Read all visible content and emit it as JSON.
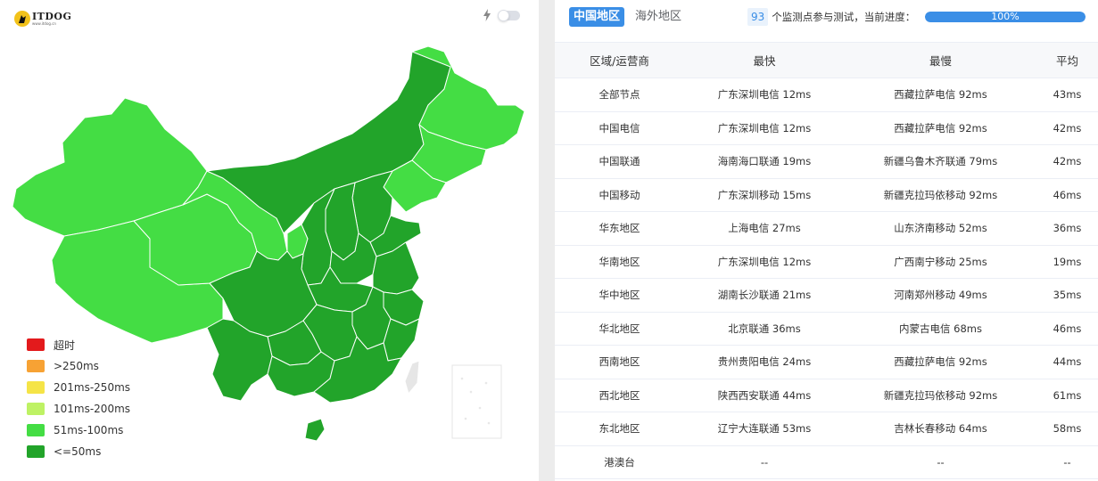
{
  "logo": {
    "name": "ITDOG",
    "url": "www.itdog.cn"
  },
  "colors": {
    "timeout": "#e31a1c",
    "over250": "#f7a234",
    "r201_250": "#f5e447",
    "r101_200": "#bef264",
    "r51_100": "#44dd44",
    "le50": "#22a42a",
    "accent": "#3a8ee6"
  },
  "legend": [
    {
      "label": "超时",
      "color": "#e31a1c"
    },
    {
      "label": ">250ms",
      "color": "#f7a234"
    },
    {
      "label": "201ms-250ms",
      "color": "#f5e447"
    },
    {
      "label": "101ms-200ms",
      "color": "#bef264"
    },
    {
      "label": "51ms-100ms",
      "color": "#44dd44"
    },
    {
      "label": "<=50ms",
      "color": "#22a42a"
    }
  ],
  "tabs": [
    {
      "label": "中国地区",
      "active": true
    },
    {
      "label": "海外地区",
      "active": false
    }
  ],
  "stat": {
    "count": "93",
    "text": "个监测点参与测试，当前进度："
  },
  "progress": {
    "value": 1.0,
    "label": "100%"
  },
  "table": {
    "headers": [
      "区域/运营商",
      "最快",
      "最慢",
      "平均"
    ],
    "rows": [
      [
        "全部节点",
        "广东深圳电信 12ms",
        "西藏拉萨电信 92ms",
        "43ms"
      ],
      [
        "中国电信",
        "广东深圳电信 12ms",
        "西藏拉萨电信 92ms",
        "42ms"
      ],
      [
        "中国联通",
        "海南海口联通 19ms",
        "新疆乌鲁木齐联通 79ms",
        "42ms"
      ],
      [
        "中国移动",
        "广东深圳移动 15ms",
        "新疆克拉玛依移动 92ms",
        "46ms"
      ],
      [
        "华东地区",
        "上海电信 27ms",
        "山东济南移动 52ms",
        "36ms"
      ],
      [
        "华南地区",
        "广东深圳电信 12ms",
        "广西南宁移动 25ms",
        "19ms"
      ],
      [
        "华中地区",
        "湖南长沙联通 21ms",
        "河南郑州移动 49ms",
        "35ms"
      ],
      [
        "华北地区",
        "北京联通 36ms",
        "内蒙古电信 68ms",
        "46ms"
      ],
      [
        "西南地区",
        "贵州贵阳电信 24ms",
        "西藏拉萨电信 92ms",
        "44ms"
      ],
      [
        "西北地区",
        "陕西西安联通 44ms",
        "新疆克拉玛依移动 92ms",
        "61ms"
      ],
      [
        "东北地区",
        "辽宁大连联通 53ms",
        "吉林长春移动 64ms",
        "58ms"
      ],
      [
        "港澳台",
        "--",
        "--",
        "--"
      ]
    ]
  }
}
